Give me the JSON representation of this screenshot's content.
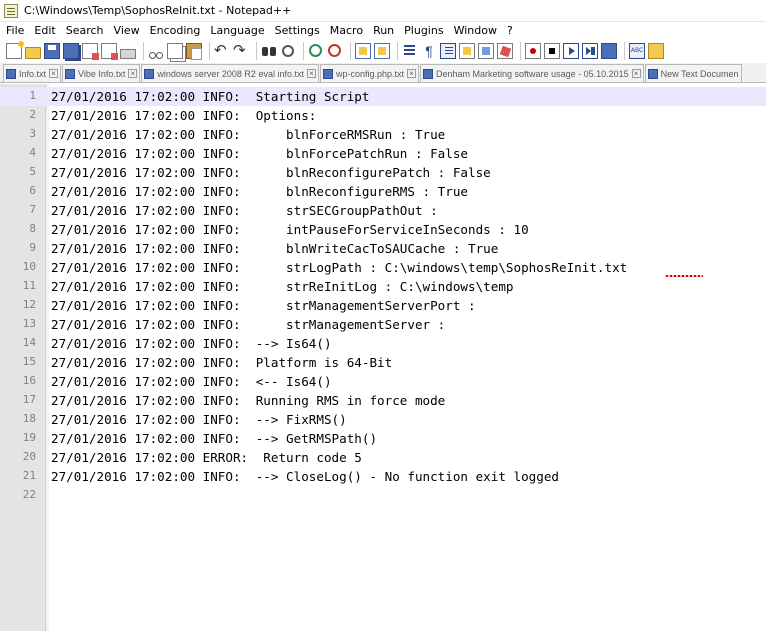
{
  "window": {
    "title": "C:\\Windows\\Temp\\SophosReInit.txt - Notepad++"
  },
  "menu": {
    "items": [
      "File",
      "Edit",
      "Search",
      "View",
      "Encoding",
      "Language",
      "Settings",
      "Macro",
      "Run",
      "Plugins",
      "Window",
      "?"
    ]
  },
  "toolbar": {
    "icons": [
      "new-file-icon",
      "open-file-icon",
      "save-icon",
      "save-all-icon",
      "close-file-icon",
      "close-all-icon",
      "print-icon",
      "cut-icon",
      "copy-icon",
      "paste-icon",
      "undo-icon",
      "redo-icon",
      "find-icon",
      "replace-icon",
      "zoom-in-icon",
      "zoom-out-icon",
      "sync-scroll-vertical-icon",
      "sync-scroll-horizontal-icon",
      "word-wrap-icon",
      "show-all-characters-icon",
      "indent-guide-icon",
      "document-map-icon",
      "function-list-icon",
      "folder-workspace-icon",
      "record-macro-icon",
      "stop-recording-icon",
      "playback-macro-icon",
      "run-macro-multiple-icon",
      "save-macro-icon",
      "spell-check-icon",
      "spell-check-options-icon"
    ]
  },
  "tabs": [
    {
      "label": "Info.txt"
    },
    {
      "label": "Vibe Info.txt"
    },
    {
      "label": "windows server 2008 R2 eval info.txt"
    },
    {
      "label": "wp-config.php.txt"
    },
    {
      "label": "Denham Marketing software usage - 05.10.2015"
    },
    {
      "label": "New Text Documen"
    }
  ],
  "editor": {
    "current_line": 1,
    "lines": [
      {
        "n": "1",
        "text": "27/01/2016 17:02:00 INFO:  Starting Script"
      },
      {
        "n": "2",
        "text": "27/01/2016 17:02:00 INFO:  Options:"
      },
      {
        "n": "3",
        "text": "27/01/2016 17:02:00 INFO:      blnForceRMSRun : True"
      },
      {
        "n": "4",
        "text": "27/01/2016 17:02:00 INFO:      blnForcePatchRun : False"
      },
      {
        "n": "5",
        "text": "27/01/2016 17:02:00 INFO:      blnReconfigurePatch : False"
      },
      {
        "n": "6",
        "text": "27/01/2016 17:02:00 INFO:      blnReconfigureRMS : True"
      },
      {
        "n": "7",
        "text": "27/01/2016 17:02:00 INFO:      strSECGroupPathOut :"
      },
      {
        "n": "8",
        "text": "27/01/2016 17:02:00 INFO:      intPauseForServiceInSeconds : 10"
      },
      {
        "n": "9",
        "text": "27/01/2016 17:02:00 INFO:      blnWriteCacToSAUCache : True"
      },
      {
        "n": "10",
        "text": "27/01/2016 17:02:00 INFO:      strLogPath : C:\\windows\\temp\\SophosReInit.txt"
      },
      {
        "n": "11",
        "text": "27/01/2016 17:02:00 INFO:      strReInitLog : C:\\windows\\temp"
      },
      {
        "n": "12",
        "text": "27/01/2016 17:02:00 INFO:      strManagementServerPort :"
      },
      {
        "n": "13",
        "text": "27/01/2016 17:02:00 INFO:      strManagementServer :"
      },
      {
        "n": "14",
        "text": "27/01/2016 17:02:00 INFO:  --> Is64()"
      },
      {
        "n": "15",
        "text": "27/01/2016 17:02:00 INFO:  Platform is 64-Bit"
      },
      {
        "n": "16",
        "text": "27/01/2016 17:02:00 INFO:  <-- Is64()"
      },
      {
        "n": "17",
        "text": "27/01/2016 17:02:00 INFO:  Running RMS in force mode"
      },
      {
        "n": "18",
        "text": "27/01/2016 17:02:00 INFO:  --> FixRMS()"
      },
      {
        "n": "19",
        "text": "27/01/2016 17:02:00 INFO:  --> GetRMSPath()"
      },
      {
        "n": "20",
        "text": "27/01/2016 17:02:00 ERROR:  Return code 5"
      },
      {
        "n": "21",
        "text": "27/01/2016 17:02:00 INFO:  --> CloseLog() - No function exit logged"
      },
      {
        "n": "22",
        "text": ""
      }
    ]
  },
  "colors": {
    "current_line_highlight": "#e8e8ff",
    "gutter_background": "#e4e4e4",
    "line_number_text": "#808080",
    "spellcheck_underline": "#e00000"
  }
}
